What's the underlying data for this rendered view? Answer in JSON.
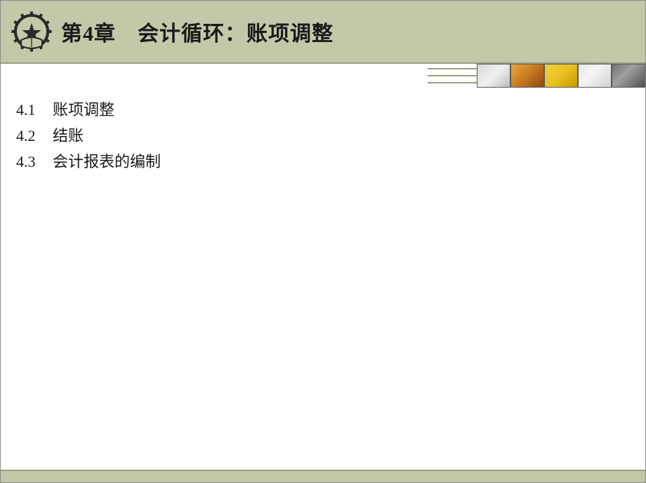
{
  "header": {
    "title": "第4章　会计循环：账项调整"
  },
  "toc": [
    {
      "number": "4.1",
      "label": "账项调整"
    },
    {
      "number": "4.2",
      "label": "结账"
    },
    {
      "number": "4.3",
      "label": "会计报表的编制"
    }
  ],
  "thumbnails": [
    {
      "name": "thumb-pen"
    },
    {
      "name": "thumb-hands"
    },
    {
      "name": "thumb-clock"
    },
    {
      "name": "thumb-fan"
    },
    {
      "name": "thumb-people"
    }
  ]
}
